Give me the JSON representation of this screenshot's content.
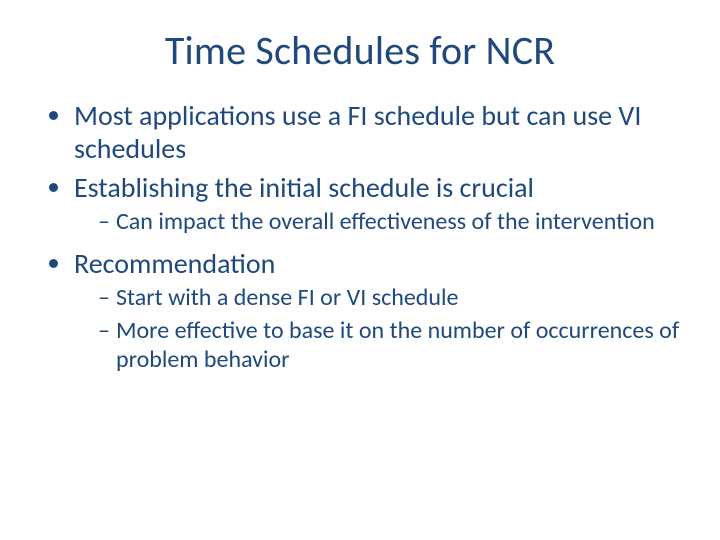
{
  "title": "Time Schedules for NCR",
  "bullets": {
    "b1": "Most applications use a FI schedule but can use VI schedules",
    "b2": "Establishing the initial schedule is crucial",
    "b2_sub": {
      "s1": "Can impact the overall effectiveness of the intervention"
    },
    "b3": "Recommendation",
    "b3_sub": {
      "s1": "Start with a dense FI or VI schedule",
      "s2": "More effective to base it on the number of occurrences of problem behavior"
    }
  }
}
